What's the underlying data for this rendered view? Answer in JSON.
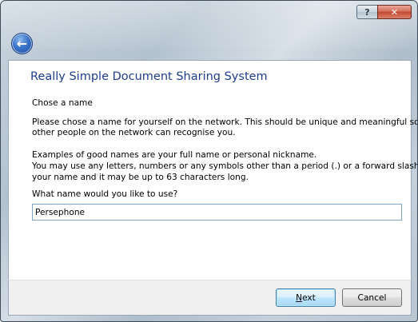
{
  "window": {
    "help_label": "?",
    "close_label": "✕",
    "back_label": "←"
  },
  "wizard": {
    "title": "Really Simple Document Sharing System",
    "section_label": "Chose a name",
    "description_line1": "Please chose a name for yourself on the network. This should be unique and meaningful so that",
    "description_line2": "other people on the network can recognise you.",
    "examples_line1": "Examples of good names are your full name or personal nickname.",
    "examples_line2": "You may use any letters, numbers or any symbols other than a period (.) or a forward slash (/) in",
    "examples_line3": "your name and it may be up to 63 characters long.",
    "prompt_label": "What name would you like to use?",
    "name_value": "Persephone"
  },
  "buttons": {
    "next_access_key": "N",
    "next_rest": "ext",
    "cancel_label": "Cancel"
  },
  "colors": {
    "heading": "#1e3d8f",
    "default_button_border": "#3c7fb1"
  }
}
